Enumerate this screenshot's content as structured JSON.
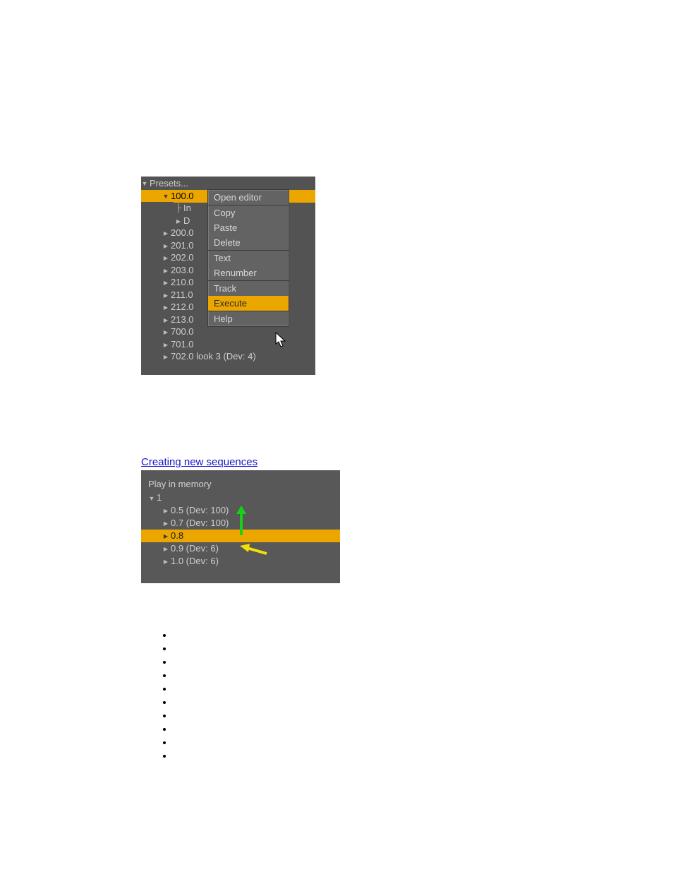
{
  "presets_tree": {
    "root_label": "Presets...",
    "selected_label": "100.0",
    "child_in": "In",
    "child_d": "D",
    "items": [
      "200.0",
      "201.0",
      "202.0",
      "203.0",
      "210.0",
      "211.0",
      "212.0",
      "213.0",
      "700.0",
      "701.0"
    ],
    "last_item": "702.0 look 3 (Dev: 4)"
  },
  "context_menu": {
    "open_editor": "Open editor",
    "copy": "Copy",
    "paste": "Paste",
    "delete": "Delete",
    "text": "Text",
    "renumber": "Renumber",
    "track": "Track",
    "execute": "Execute",
    "help": "Help"
  },
  "link_text": "Creating new sequences",
  "memory_panel": {
    "title": "Play in memory",
    "root": "1",
    "rows": [
      "0.5 (Dev: 100)",
      "0.7 (Dev: 100)",
      "0.8",
      "0.9 (Dev: 6)",
      "1.0 (Dev: 6)"
    ],
    "selected_index": 2
  }
}
